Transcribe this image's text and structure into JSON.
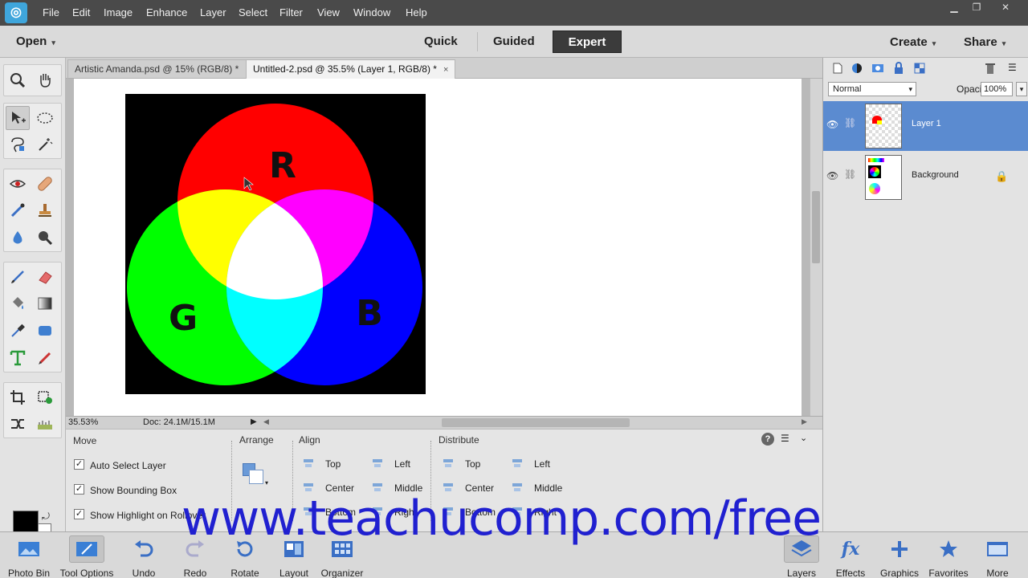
{
  "menubar": {
    "items": [
      "File",
      "Edit",
      "Image",
      "Enhance",
      "Layer",
      "Select",
      "Filter",
      "View",
      "Window",
      "Help"
    ]
  },
  "modebar": {
    "open_label": "Open",
    "quick_label": "Quick",
    "guided_label": "Guided",
    "expert_label": "Expert",
    "create_label": "Create",
    "share_label": "Share"
  },
  "tabs": [
    {
      "label": "Artistic Amanda.psd @ 15% (RGB/8) *",
      "close": "×"
    },
    {
      "label": "Untitled-2.psd @ 35.5% (Layer 1, RGB/8) *",
      "close": "×"
    }
  ],
  "artwork": {
    "label_r": "R",
    "label_g": "G",
    "label_b": "B"
  },
  "status": {
    "zoom": "35.53%",
    "doc_size": "Doc: 24.1M/15.1M"
  },
  "tool_options": {
    "tool_name": "Move",
    "checkboxes": [
      {
        "label": "Auto Select Layer",
        "checked": "✓"
      },
      {
        "label": "Show Bounding Box",
        "checked": "✓"
      },
      {
        "label": "Show Highlight on Rollover",
        "checked": "✓"
      }
    ],
    "arrange_label": "Arrange",
    "align_label": "Align",
    "align_items": [
      "Top",
      "Left",
      "Center",
      "Middle",
      "Bottom",
      "Right"
    ],
    "distribute_label": "Distribute",
    "distribute_items": [
      "Top",
      "Left",
      "Center",
      "Middle",
      "Bottom",
      "Right"
    ],
    "help": "?"
  },
  "layers_panel": {
    "blend_mode": "Normal",
    "opacity_label": "Opacity:",
    "opacity_value": "100%",
    "layers": [
      {
        "name": "Layer 1"
      },
      {
        "name": "Background"
      }
    ]
  },
  "taskbar": {
    "left": [
      {
        "label": "Photo Bin"
      },
      {
        "label": "Tool Options"
      },
      {
        "label": "Undo"
      },
      {
        "label": "Redo"
      },
      {
        "label": "Rotate"
      },
      {
        "label": "Layout"
      },
      {
        "label": "Organizer"
      }
    ],
    "right": [
      {
        "label": "Layers"
      },
      {
        "label": "Effects"
      },
      {
        "label": "Graphics"
      },
      {
        "label": "Favorites"
      },
      {
        "label": "More"
      }
    ]
  },
  "watermark": "www.teachucomp.com/free",
  "colors": {
    "accent": "#5b8bd0",
    "menubar": "#4a4a4a",
    "foreground": "#000000",
    "background": "#ffffff"
  }
}
